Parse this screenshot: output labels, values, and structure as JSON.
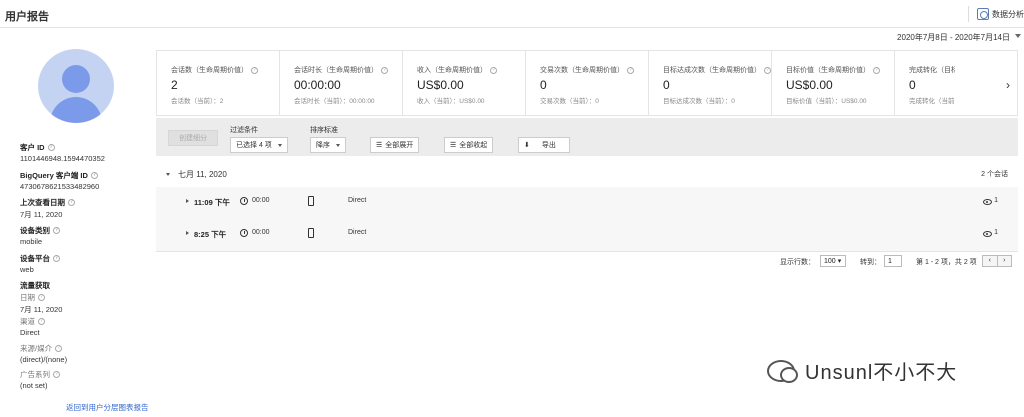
{
  "header": {
    "title": "用户报告",
    "analysis_label": "数据分析",
    "date_range": "2020年7月8日 - 2020年7月14日"
  },
  "sidebar": {
    "fields": [
      {
        "label": "客户 ID",
        "value": "1101446948.1594470352"
      },
      {
        "label": "BigQuery 客户端 ID",
        "value": "4730678621533482960"
      },
      {
        "label": "上次查看日期",
        "value": "7月 11, 2020"
      },
      {
        "label": "设备类别",
        "value": "mobile"
      },
      {
        "label": "设备平台",
        "value": "web"
      },
      {
        "label": "流量获取",
        "value": "日期",
        "value2": "7月 11, 2020"
      },
      {
        "label": "渠道",
        "value": "Direct"
      },
      {
        "label": "来源/媒介",
        "value": "(direct)/(none)"
      },
      {
        "label": "广告系列",
        "value": "(not set)"
      }
    ],
    "back_link": "返回到用户分层图表报告"
  },
  "metrics": [
    {
      "label": "会话数（生命周期价值）",
      "value": "2",
      "sub": "会话数（当前）：2"
    },
    {
      "label": "会话时长（生命周期价值）",
      "value": "00:00:00",
      "sub": "会话时长（当前）：00:00:00"
    },
    {
      "label": "收入（生命周期价值）",
      "value": "US$0.00",
      "sub": "收入（当前）：US$0.00"
    },
    {
      "label": "交易次数（生命周期价值）",
      "value": "0",
      "sub": "交易次数（当前）：0"
    },
    {
      "label": "目标达成次数（生命周期价值）",
      "value": "0",
      "sub": "目标达成次数（当前）：0"
    },
    {
      "label": "目标价值（生命周期价值）",
      "value": "US$0.00",
      "sub": "目标价值（当前）：US$0.00"
    },
    {
      "label": "完成转化（目标",
      "value": "0",
      "sub": "完成转化（当前"
    }
  ],
  "next_arrow": "›",
  "toolbar": {
    "segment_button": "创建细分",
    "filter_label": "过滤条件",
    "filter_value": "已选择 4 项",
    "sort_label": "排序标准",
    "sort_value": "降序",
    "expand_all": "全部展开",
    "collapse_all": "全部收起",
    "export": "导出"
  },
  "sessions": {
    "date": "七月 11, 2020",
    "count": "2 个会话",
    "rows": [
      {
        "time": "11:09 下午",
        "duration": "00:00",
        "source": "Direct",
        "views": "1"
      },
      {
        "time": "8:25 下午",
        "duration": "00:00",
        "source": "Direct",
        "views": "1"
      }
    ]
  },
  "pager": {
    "rows_label": "显示行数：",
    "rows_value": "100",
    "goto_label": "转到：",
    "goto_value": "1",
    "range": "第 1 - 2 项，共 2 项",
    "prev": "‹",
    "next": "›"
  },
  "watermark": "Unsunl不小不大"
}
